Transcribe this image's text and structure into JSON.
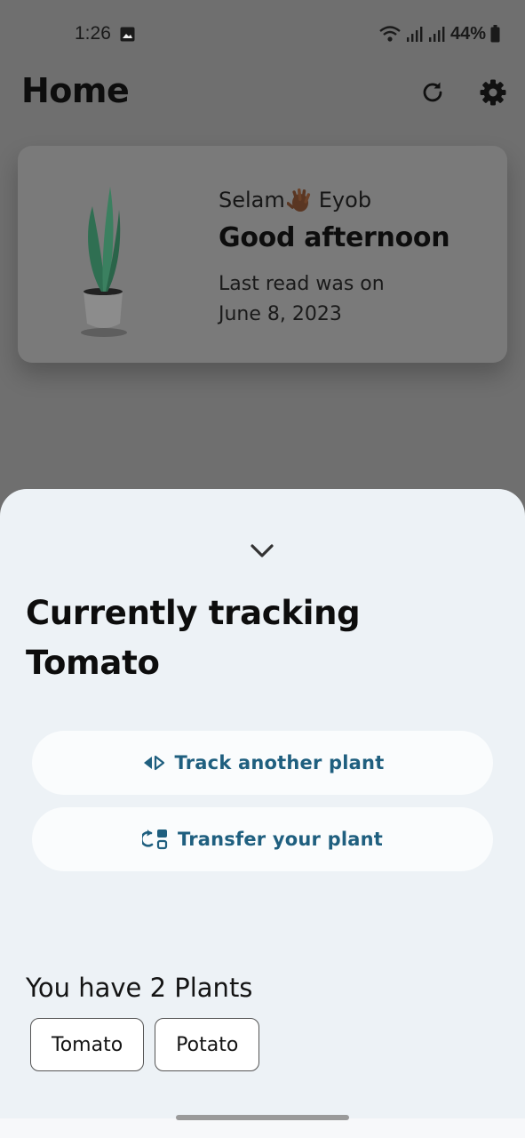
{
  "status_bar": {
    "time": "1:26",
    "battery": "44%",
    "icons": [
      "image-icon",
      "wifi-icon",
      "signal-icon",
      "signal-icon",
      "battery-icon"
    ]
  },
  "header": {
    "title": "Home",
    "actions": [
      "refresh-icon",
      "gear-icon"
    ]
  },
  "greeting_card": {
    "name_prefix": "Selam",
    "name_suffix": "Eyob",
    "greeting": "Good afternoon",
    "last_read": "Last read was on June 8, 2023"
  },
  "bottom_sheet": {
    "title": "Currently tracking Tomato",
    "track_label": "Track another plant",
    "transfer_label": "Transfer your plant",
    "plants_count": "You have 2 Plants",
    "plants": [
      "Tomato",
      "Potato"
    ]
  },
  "colors": {
    "accent": "#1f5f7f",
    "sheet_bg": "#edf2f6",
    "scrim": "#6f6f6f",
    "plant_green": "#2f6f52"
  }
}
